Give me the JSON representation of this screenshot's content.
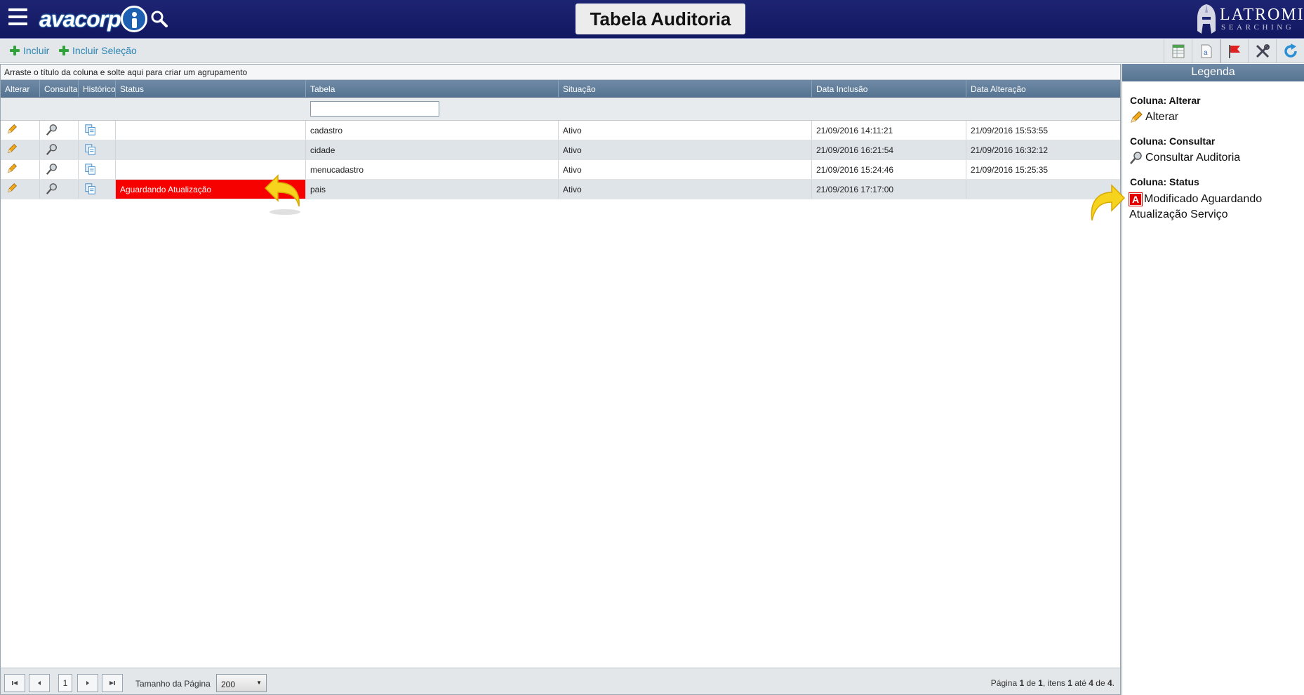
{
  "header": {
    "logo_text": "avacorp",
    "title": "Tabela Auditoria",
    "brand_name": "LATROMI",
    "brand_sub": "SEARCHING"
  },
  "toolbar": {
    "add_label": "Incluir",
    "add_selection_label": "Incluir Seleção"
  },
  "grid": {
    "group_hint": "Arraste o título da coluna e solte aqui para criar um agrupamento",
    "columns": [
      "Alterar",
      "Consultar",
      "Histórico",
      "Status",
      "Tabela",
      "Situação",
      "Data Inclusão",
      "Data Alteração"
    ],
    "rows": [
      {
        "status": "",
        "tabela": "cadastro",
        "situacao": "Ativo",
        "inclusao": "21/09/2016 14:11:21",
        "alteracao": "21/09/2016 15:53:55"
      },
      {
        "status": "",
        "tabela": "cidade",
        "situacao": "Ativo",
        "inclusao": "21/09/2016 16:21:54",
        "alteracao": "21/09/2016 16:32:12"
      },
      {
        "status": "",
        "tabela": "menucadastro",
        "situacao": "Ativo",
        "inclusao": "21/09/2016 15:24:46",
        "alteracao": "21/09/2016 15:25:35"
      },
      {
        "status": "Aguardando Atualização",
        "tabela": "pais",
        "situacao": "Ativo",
        "inclusao": "21/09/2016 17:17:00",
        "alteracao": ""
      }
    ]
  },
  "pager": {
    "current_page": "1",
    "size_label": "Tamanho da Página",
    "size_value": "200",
    "info_prefix": "Página ",
    "info_page": "1",
    "info_of": " de ",
    "info_pages": "1",
    "info_items": ", itens ",
    "info_from": "1",
    "info_to_word": " até ",
    "info_to": "4",
    "info_total_word": " de ",
    "info_total": "4",
    "info_end": "."
  },
  "legend": {
    "title": "Legenda",
    "sections": [
      {
        "title": "Coluna: Alterar",
        "item": "Alterar"
      },
      {
        "title": "Coluna: Consultar",
        "item": "Consultar Auditoria"
      },
      {
        "title": "Coluna: Status",
        "badge": "A",
        "item": "Modificado Aguardando Atualização Serviço"
      }
    ]
  },
  "colors": {
    "header_bg": "#1d2472",
    "status_red": "#f60000",
    "accent_link": "#2a86b5",
    "column_header": "#6f8aa6"
  }
}
